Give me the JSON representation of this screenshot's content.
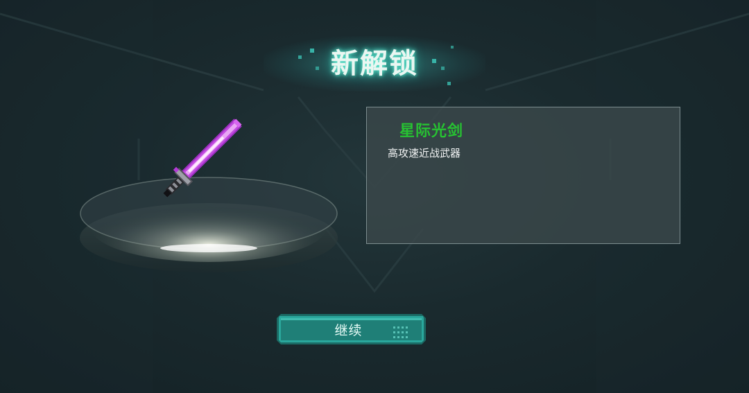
{
  "header": {
    "title": "新解锁"
  },
  "item": {
    "name": "星际光剑",
    "description": "高攻速近战武器",
    "name_color": "#27c232",
    "blade_color": "#c24be0"
  },
  "actions": {
    "continue_label": "继续"
  },
  "colors": {
    "accent": "#3fd0c0",
    "background": "#1a2a2e"
  },
  "icons": {
    "weapon": "lightsaber-icon",
    "grip_dots": "dot-grid-icon"
  }
}
